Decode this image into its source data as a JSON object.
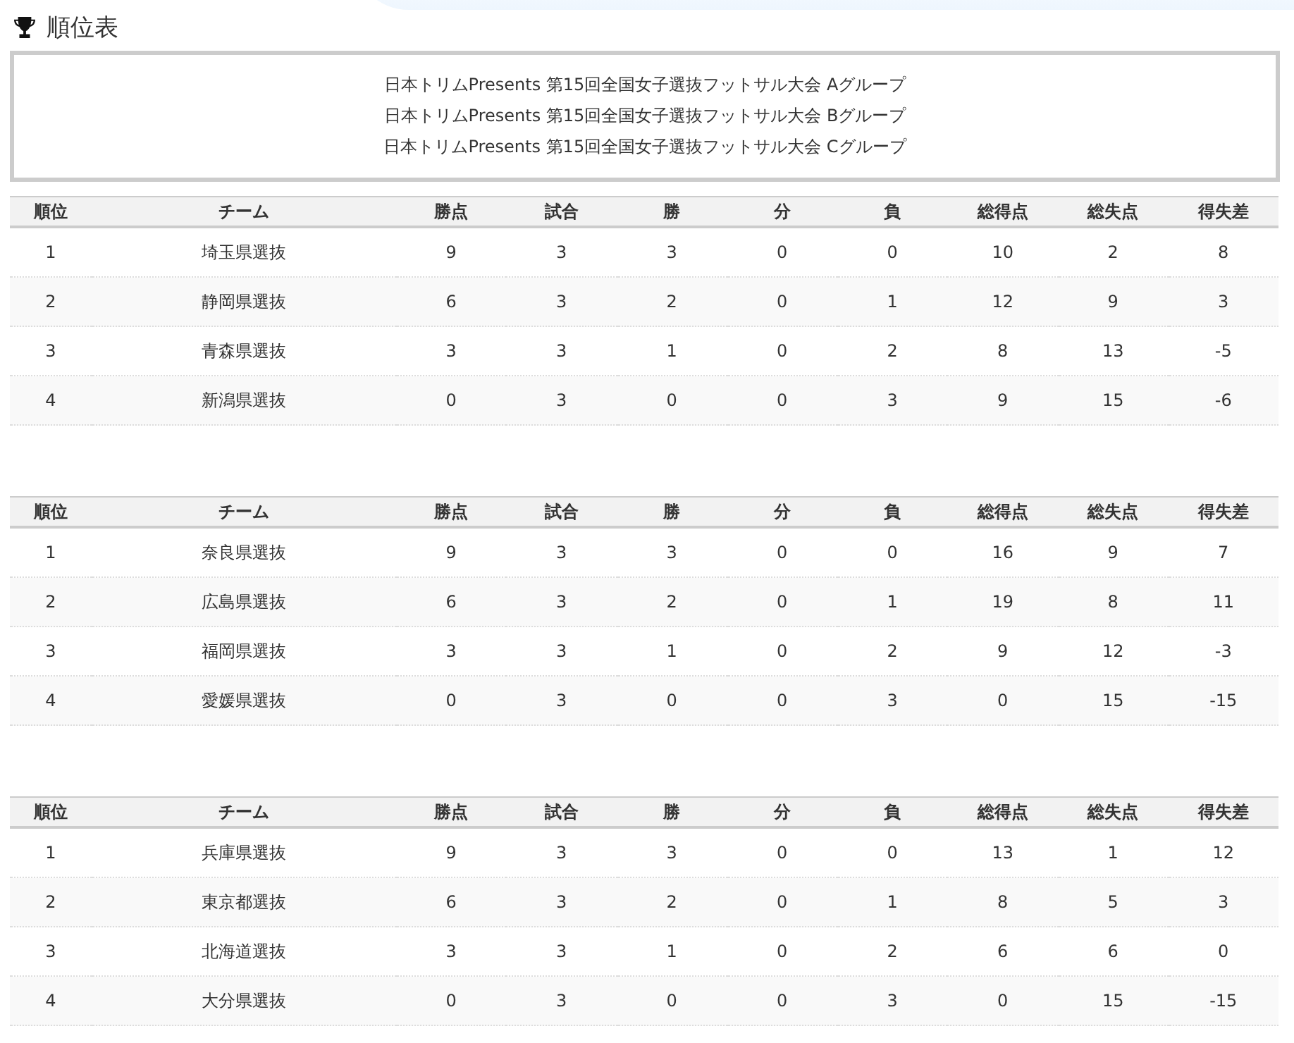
{
  "title": "順位表",
  "groups": [
    "日本トリムPresents 第15回全国女子選抜フットサル大会 Aグループ",
    "日本トリムPresents 第15回全国女子選抜フットサル大会 Bグループ",
    "日本トリムPresents 第15回全国女子選抜フットサル大会 Cグループ"
  ],
  "tables": [
    {
      "columns": [
        "順位",
        "チーム",
        "勝点",
        "試合",
        "勝",
        "分",
        "負",
        "総得点",
        "総失点",
        "得失差"
      ],
      "rows": [
        [
          "1",
          "埼玉県選抜",
          "9",
          "3",
          "3",
          "0",
          "0",
          "10",
          "2",
          "8"
        ],
        [
          "2",
          "静岡県選抜",
          "6",
          "3",
          "2",
          "0",
          "1",
          "12",
          "9",
          "3"
        ],
        [
          "3",
          "青森県選抜",
          "3",
          "3",
          "1",
          "0",
          "2",
          "8",
          "13",
          "-5"
        ],
        [
          "4",
          "新潟県選抜",
          "0",
          "3",
          "0",
          "0",
          "3",
          "9",
          "15",
          "-6"
        ]
      ]
    },
    {
      "columns": [
        "順位",
        "チーム",
        "勝点",
        "試合",
        "勝",
        "分",
        "負",
        "総得点",
        "総失点",
        "得失差"
      ],
      "rows": [
        [
          "1",
          "奈良県選抜",
          "9",
          "3",
          "3",
          "0",
          "0",
          "16",
          "9",
          "7"
        ],
        [
          "2",
          "広島県選抜",
          "6",
          "3",
          "2",
          "0",
          "1",
          "19",
          "8",
          "11"
        ],
        [
          "3",
          "福岡県選抜",
          "3",
          "3",
          "1",
          "0",
          "2",
          "9",
          "12",
          "-3"
        ],
        [
          "4",
          "愛媛県選抜",
          "0",
          "3",
          "0",
          "0",
          "3",
          "0",
          "15",
          "-15"
        ]
      ]
    },
    {
      "columns": [
        "順位",
        "チーム",
        "勝点",
        "試合",
        "勝",
        "分",
        "負",
        "総得点",
        "総失点",
        "得失差"
      ],
      "rows": [
        [
          "1",
          "兵庫県選抜",
          "9",
          "3",
          "3",
          "0",
          "0",
          "13",
          "1",
          "12"
        ],
        [
          "2",
          "東京都選抜",
          "6",
          "3",
          "2",
          "0",
          "1",
          "8",
          "5",
          "3"
        ],
        [
          "3",
          "北海道選抜",
          "3",
          "3",
          "1",
          "0",
          "2",
          "6",
          "6",
          "0"
        ],
        [
          "4",
          "大分県選抜",
          "0",
          "3",
          "0",
          "0",
          "3",
          "0",
          "15",
          "-15"
        ]
      ]
    }
  ]
}
